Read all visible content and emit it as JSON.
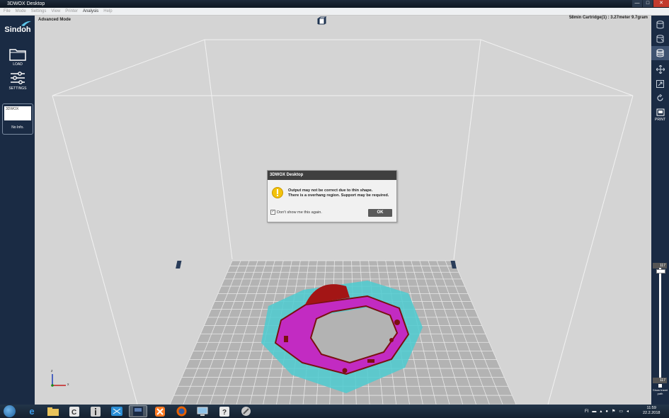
{
  "window": {
    "title": "3DWOX Desktop",
    "controls": [
      "—",
      "□",
      "✕"
    ]
  },
  "menu": [
    {
      "label": "File"
    },
    {
      "label": "Mode"
    },
    {
      "label": "Settings"
    },
    {
      "label": "View"
    },
    {
      "label": "Printer"
    },
    {
      "label": "Analysis"
    },
    {
      "label": "Help"
    }
  ],
  "sidebar": {
    "brand": "Sindoh",
    "load_label": "LOAD",
    "settings_label": "SETTINGS",
    "printer": {
      "name": "3DWOX",
      "info": "No Info."
    }
  },
  "viewport": {
    "mode_label": "Advanced Mode",
    "status": "58min  Cartridge(1) : 3.27meter 9.7gram",
    "axis": {
      "z": "z",
      "x": "x"
    }
  },
  "right_toolbar": {
    "print_label": "PRINT",
    "layer_top": "117",
    "layer_bottom": "117",
    "travel_label": "Show travel path"
  },
  "dialog": {
    "title": "3DWOX Desktop",
    "message_line1": "Output may not be correct due to thin shape.",
    "message_line2": "There is a overhang region. Support may be required.",
    "checkbox_label": "Don't show me this again.",
    "checkbox_checked": true,
    "ok_label": "OK"
  },
  "taskbar": {
    "tray_lang": "FI",
    "time": "11:59",
    "date": "22.2.2018"
  },
  "colors": {
    "sidebar": "#1a2b44",
    "model_fill": "#c22bc2",
    "model_edge": "#7a1010",
    "support": "#44c4c8"
  }
}
